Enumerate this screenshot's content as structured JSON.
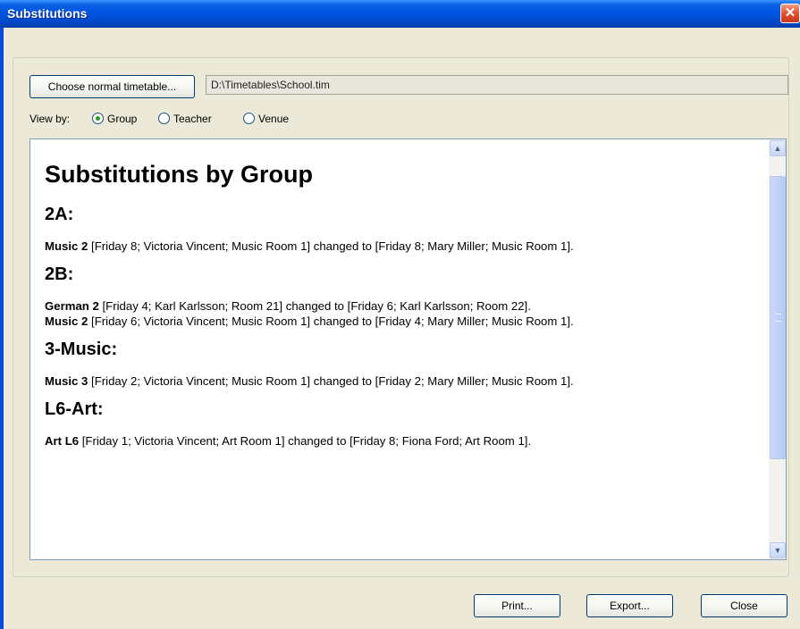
{
  "window": {
    "title": "Substitutions",
    "close_glyph": "✕"
  },
  "toolbar": {
    "choose_label": "Choose normal timetable...",
    "path_value": "D:\\Timetables\\School.tim",
    "viewby_label": "View by:",
    "options": [
      {
        "label": "Group",
        "selected": true
      },
      {
        "label": "Teacher",
        "selected": false
      },
      {
        "label": "Venue",
        "selected": false
      }
    ]
  },
  "report": {
    "title": "Substitutions by Group",
    "groups": [
      {
        "heading": "2A:",
        "items": [
          {
            "subject": "Music 2",
            "text": " [Friday 8; Victoria Vincent; Music Room 1] changed to [Friday 8; Mary Miller; Music Room 1]."
          }
        ]
      },
      {
        "heading": "2B:",
        "items": [
          {
            "subject": "German 2",
            "text": " [Friday 4; Karl Karlsson; Room 21] changed to [Friday 6; Karl Karlsson; Room 22]."
          },
          {
            "subject": "Music 2",
            "text": " [Friday 6; Victoria Vincent; Music Room 1] changed to [Friday 4; Mary Miller; Music Room 1]."
          }
        ]
      },
      {
        "heading": "3-Music:",
        "items": [
          {
            "subject": "Music 3",
            "text": " [Friday 2; Victoria Vincent; Music Room 1] changed to [Friday 2; Mary Miller; Music Room 1]."
          }
        ]
      },
      {
        "heading": "L6-Art:",
        "items": [
          {
            "subject": "Art L6",
            "text": " [Friday 1; Victoria Vincent; Art Room 1] changed to [Friday 8; Fiona Ford; Art Room 1]."
          }
        ]
      }
    ]
  },
  "scrollbar": {
    "up_glyph": "▲",
    "down_glyph": "▼"
  },
  "buttons": {
    "print": "Print...",
    "export": "Export...",
    "close": "Close"
  }
}
